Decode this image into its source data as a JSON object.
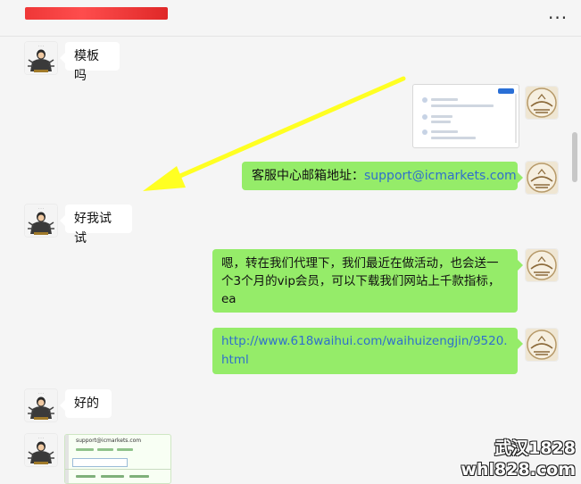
{
  "header": {
    "title": "",
    "more_label": "···"
  },
  "messages": [
    {
      "side": "in",
      "text": "模板吗"
    },
    {
      "side": "out",
      "type": "image"
    },
    {
      "side": "out",
      "prefix": "客服中心邮箱地址：",
      "link": "support@icmarkets.com"
    },
    {
      "side": "in",
      "text": "好我试试"
    },
    {
      "side": "out",
      "text": "嗯，转在我们代理下，我们最近在做活动，也会送一个3个月的vip会员，可以下载我们网站上千款指标，ea"
    },
    {
      "side": "out",
      "link": "http://www.618waihui.com/waihuizengjin/9520.html"
    },
    {
      "side": "in",
      "text": "好的"
    },
    {
      "side": "in",
      "type": "image"
    }
  ],
  "email_card": {
    "address": "support@icmarkets.com"
  },
  "watermark": {
    "line1": "武汉1828",
    "line2": "whl828.com"
  },
  "colors": {
    "outgoing_bubble": "#95ec69",
    "incoming_bubble": "#ffffff",
    "link": "#2f6fcc",
    "arrow": "#ffff22",
    "background": "#f5f5f5"
  }
}
